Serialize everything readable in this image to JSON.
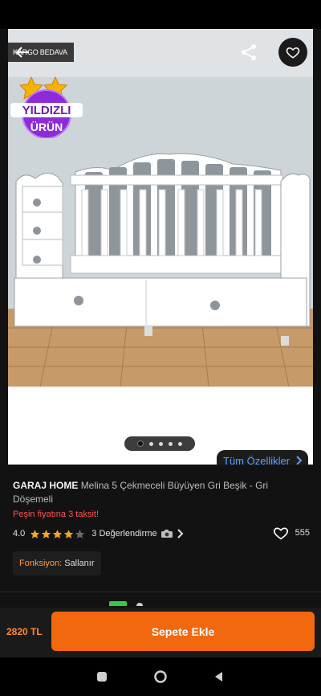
{
  "badges": {
    "cargo": "KARGO BEDAVA",
    "star_product_line1": "YILDIZLI",
    "star_product_line2": "ÜRÜN"
  },
  "carousel": {
    "dot_count": 5,
    "active_index": 0
  },
  "all_features_label": "Tüm Özellikler",
  "product": {
    "brand": "GARAJ HOME",
    "name": "Melina 5 Çekmeceli Büyüyen Gri Beşik - Gri Döşemeli",
    "installment_text": "Peşin fiyatına 3 taksit!",
    "rating": "4.0",
    "rating_stars": 4,
    "review_text": "3 Değerlendirme",
    "favorite_count": "555",
    "function_label": "Fonksiyon:",
    "function_value": "Sallanır"
  },
  "bottom_bar": {
    "price": "2820 TL",
    "add_to_cart_label": "Sepete Ekle"
  },
  "colors": {
    "accent": "#f2680f",
    "price": "#ff8a2a",
    "installment": "#ff5252",
    "link": "#5aa0ff",
    "star": "#f5a623"
  }
}
